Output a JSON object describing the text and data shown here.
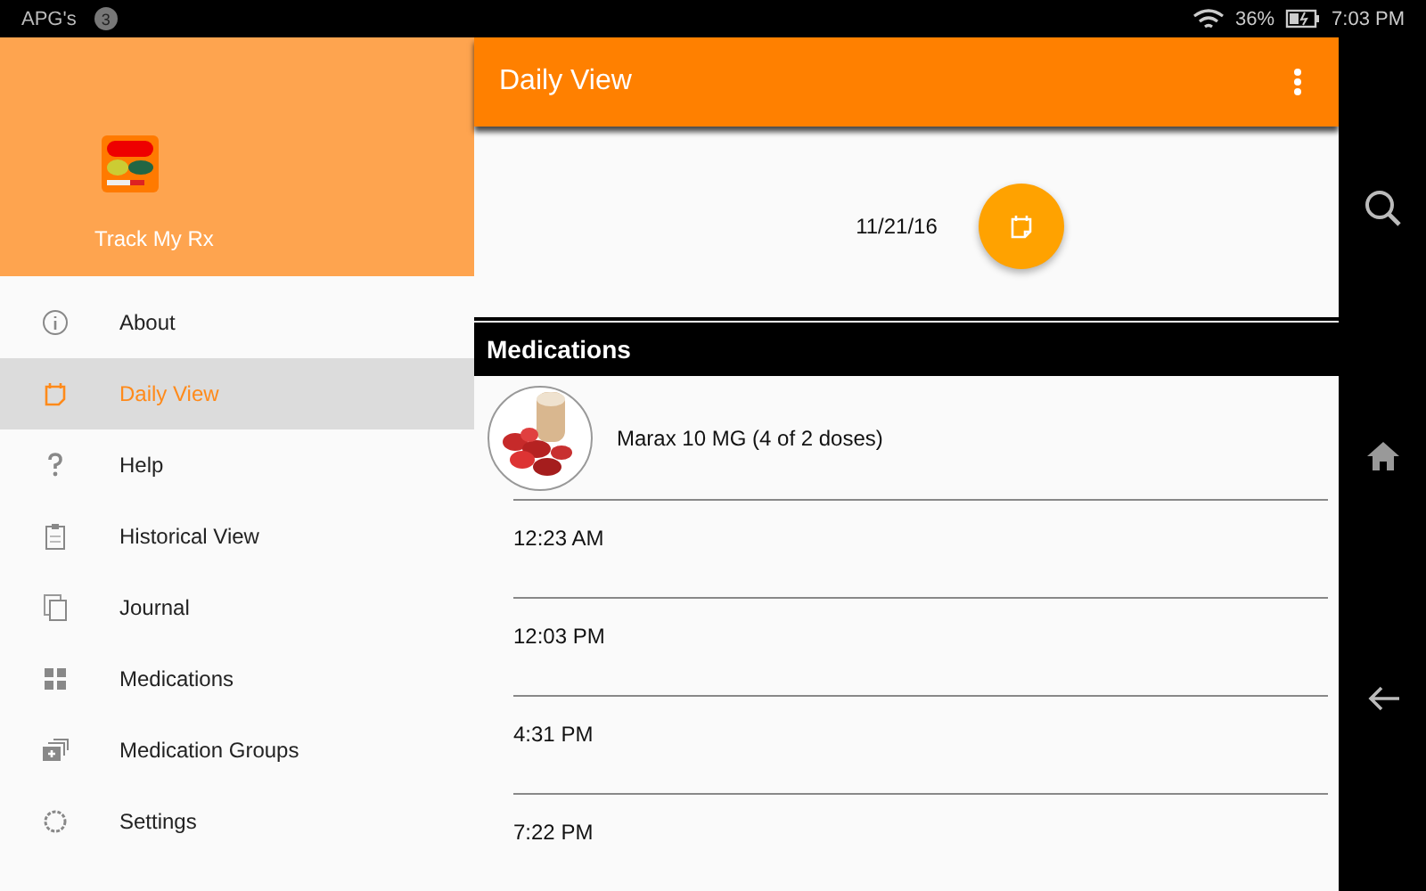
{
  "status_bar": {
    "carrier": "APG's",
    "notification_count": "3",
    "battery": "36%",
    "time": "7:03 PM"
  },
  "drawer": {
    "app_name": "Track My Rx",
    "items": [
      {
        "label": "About",
        "kind": "info",
        "selected": false
      },
      {
        "label": "Daily View",
        "kind": "calendar",
        "selected": true
      },
      {
        "label": "Help",
        "kind": "help",
        "selected": false
      },
      {
        "label": "Historical View",
        "kind": "clipboard",
        "selected": false
      },
      {
        "label": "Journal",
        "kind": "pages",
        "selected": false
      },
      {
        "label": "Medications",
        "kind": "grid",
        "selected": false
      },
      {
        "label": "Medication Groups",
        "kind": "stack",
        "selected": false
      },
      {
        "label": "Settings",
        "kind": "gear",
        "selected": false
      }
    ]
  },
  "app_bar": {
    "title": "Daily View"
  },
  "date": "11/21/16",
  "section_title": "Medications",
  "medication": {
    "name": "Marax 10 MG (4 of 2 doses)"
  },
  "dose_times": [
    "12:23 AM",
    "12:03 PM",
    "4:31 PM",
    "7:22 PM"
  ]
}
